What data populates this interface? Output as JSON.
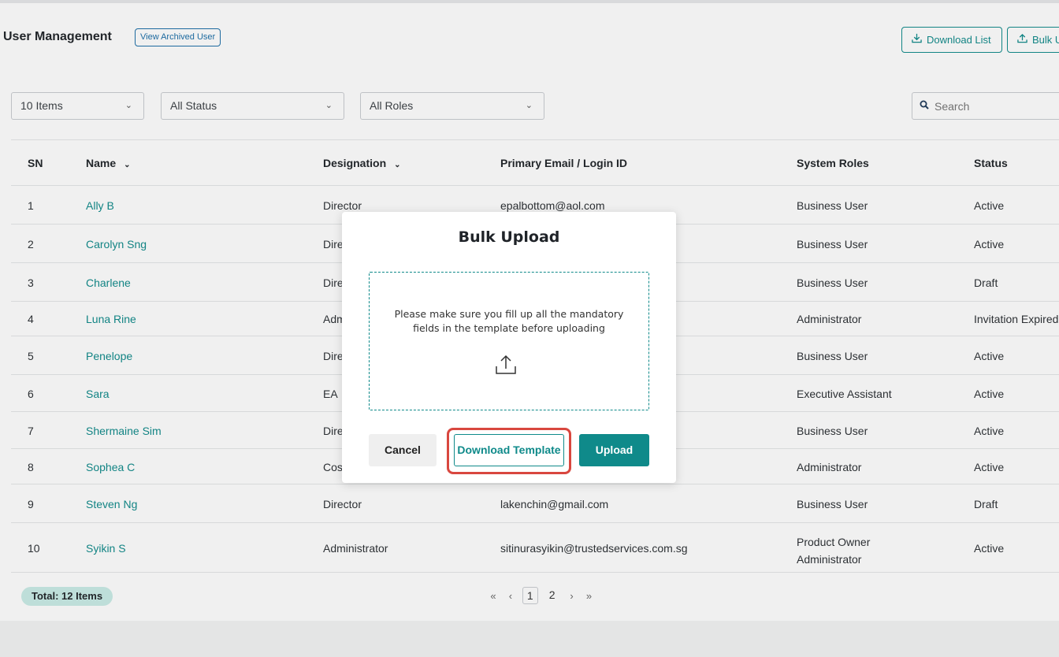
{
  "header": {
    "title": "User Management",
    "archived_link": "View Archived User",
    "download_list": "Download List",
    "bulk_upload_partial": "Bulk U"
  },
  "filters": {
    "items": "10 Items",
    "status": "All Status",
    "roles": "All Roles",
    "search_placeholder": "Search"
  },
  "table": {
    "columns": [
      "SN",
      "Name",
      "Designation",
      "Primary Email / Login ID",
      "System Roles",
      "Status"
    ],
    "rows": [
      {
        "sn": "1",
        "name": "Ally B",
        "designation": "Director",
        "email": "epalbottom@aol.com",
        "role": "Business User",
        "role2": "",
        "status": "Active"
      },
      {
        "sn": "2",
        "name": "Carolyn Sng",
        "designation": "Dire",
        "email": "",
        "role": "Business User",
        "role2": "",
        "status": "Active"
      },
      {
        "sn": "3",
        "name": "Charlene",
        "designation": "Dire",
        "email": "",
        "role": "Business User",
        "role2": "",
        "status": "Draft"
      },
      {
        "sn": "4",
        "name": "Luna Rine",
        "designation": "Adm",
        "email": "",
        "role": "Administrator",
        "role2": "",
        "status": "Invitation Expired"
      },
      {
        "sn": "5",
        "name": "Penelope",
        "designation": "Dire",
        "email": "",
        "role": "Business User",
        "role2": "",
        "status": "Active"
      },
      {
        "sn": "6",
        "name": "Sara",
        "designation": "EA",
        "email": "",
        "role": "Executive Assistant",
        "role2": "",
        "status": "Active"
      },
      {
        "sn": "7",
        "name": "Shermaine Sim",
        "designation": "Dire",
        "email": "",
        "role": "Business User",
        "role2": "",
        "status": "Active"
      },
      {
        "sn": "8",
        "name": "Sophea C",
        "designation": "Cos",
        "email": "",
        "role": "Administrator",
        "role2": "",
        "status": "Active"
      },
      {
        "sn": "9",
        "name": "Steven Ng",
        "designation": "Director",
        "email": "lakenchin@gmail.com",
        "role": "Business User",
        "role2": "",
        "status": "Draft"
      },
      {
        "sn": "10",
        "name": "Syikin S",
        "designation": "Administrator",
        "email": "sitinurasyikin@trustedservices.com.sg",
        "role": "Product Owner",
        "role2": "Administrator",
        "status": "Active"
      }
    ]
  },
  "footer": {
    "total": "Total: 12 Items",
    "pages": [
      "1",
      "2"
    ],
    "current_page": "1"
  },
  "modal": {
    "title": "Bulk Upload",
    "instructions_line1": "Please make sure you fill up all the mandatory",
    "instructions_line2": "fields in the template before uploading",
    "cancel": "Cancel",
    "download_template": "Download Template",
    "upload": "Upload"
  },
  "colors": {
    "accent": "#0f8a8a",
    "link_blue": "#1b6ea8",
    "highlight": "#d9473f",
    "badge_bg": "#c9ece6"
  }
}
